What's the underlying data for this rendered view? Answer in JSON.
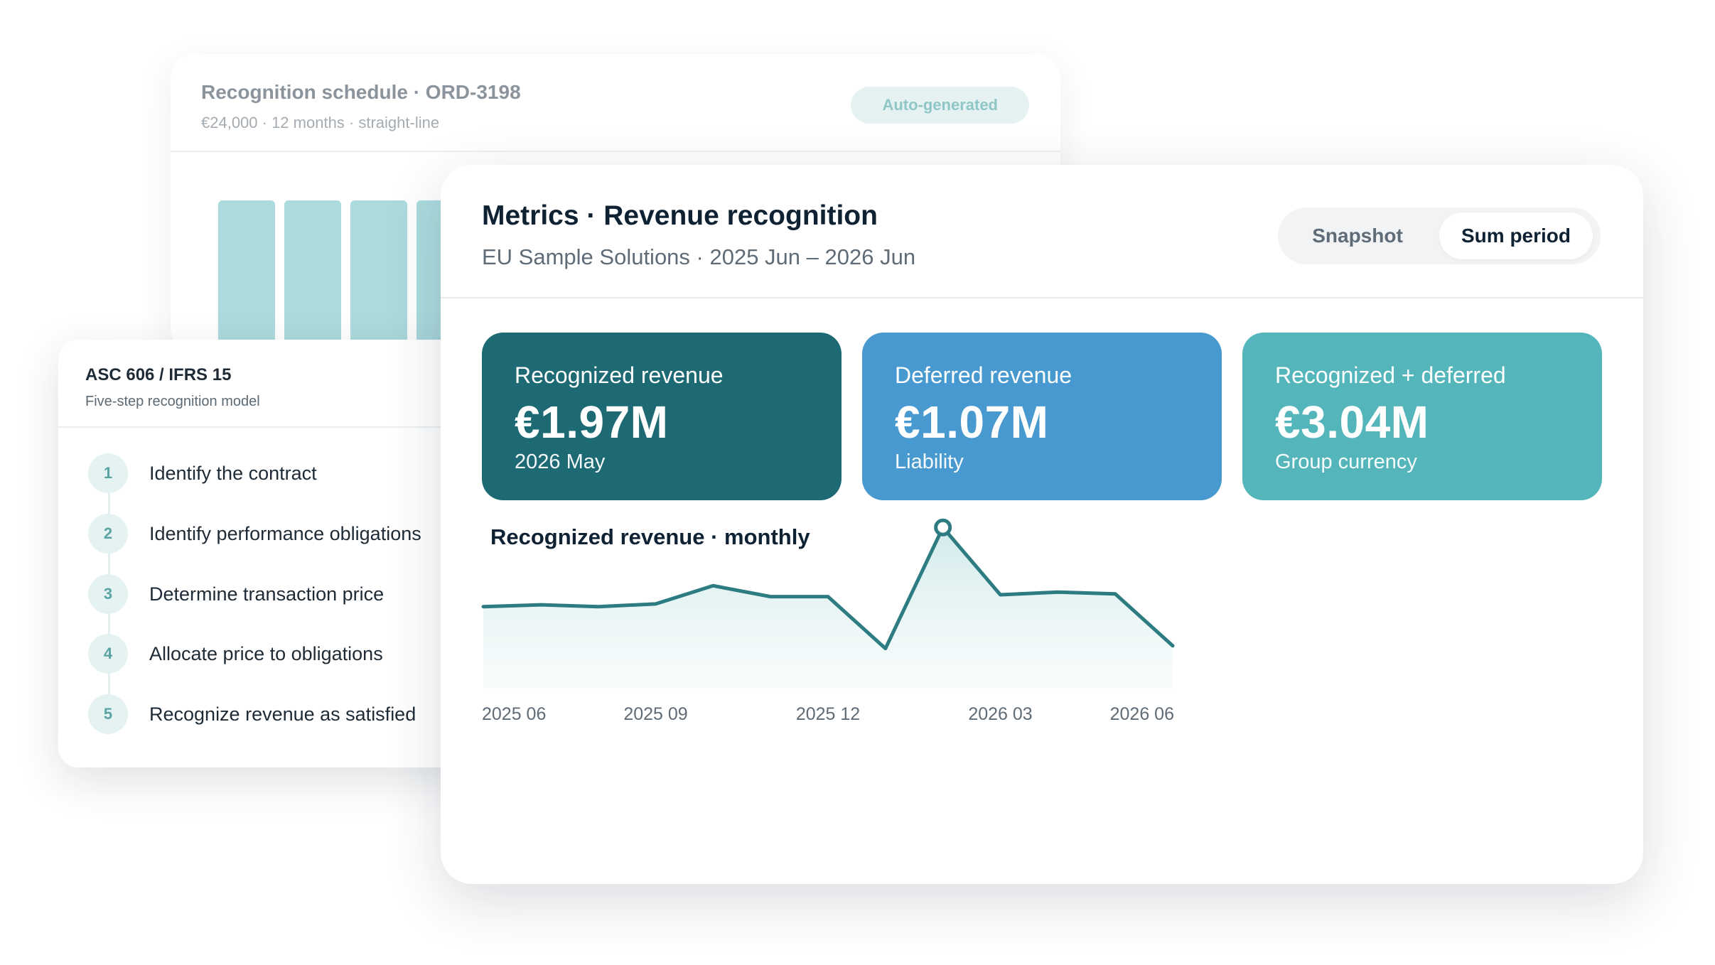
{
  "schedule_card": {
    "title": "Recognition schedule · ORD-3198",
    "subtitle": "€24,000 · 12 months · straight-line",
    "badge": "Auto-generated"
  },
  "asc_card": {
    "title": "ASC 606 / IFRS 15",
    "subtitle": "Five-step recognition model",
    "steps": [
      {
        "num": "1",
        "label": "Identify the contract"
      },
      {
        "num": "2",
        "label": "Identify performance obligations"
      },
      {
        "num": "3",
        "label": "Determine transaction price"
      },
      {
        "num": "4",
        "label": "Allocate price to obligations"
      },
      {
        "num": "5",
        "label": "Recognize revenue as satisfied"
      }
    ]
  },
  "metrics": {
    "title": "Metrics · Revenue recognition",
    "subtitle": "EU Sample Solutions · 2025 Jun – 2026 Jun",
    "toggle": {
      "snapshot": "Snapshot",
      "sum_period": "Sum period",
      "selected": "Sum period"
    },
    "kpis": [
      {
        "label": "Recognized revenue",
        "value": "€1.97M",
        "sub": "2026 May",
        "color": "#1e6a74"
      },
      {
        "label": "Deferred revenue",
        "value": "€1.07M",
        "sub": "Liability",
        "color": "#4799cf"
      },
      {
        "label": "Recognized + deferred",
        "value": "€3.04M",
        "sub": "Group currency",
        "color": "#54b6ba"
      }
    ]
  },
  "colors": {
    "line": "#2d7c82",
    "area_top": "#cfe9ea"
  },
  "chart_data": {
    "type": "area",
    "title": "Recognized revenue · monthly",
    "x": [
      "2025 06",
      "2025 07",
      "2025 08",
      "2025 09",
      "2025 10",
      "2025 11",
      "2025 12",
      "2026 01",
      "2026 02",
      "2026 03",
      "2026 04",
      "2026 05",
      "2026 06"
    ],
    "xtick_labels": [
      "2025 06",
      "2025 09",
      "2025 12",
      "2026 03",
      "2026 06"
    ],
    "values": [
      1.5,
      1.52,
      1.5,
      1.53,
      1.73,
      1.61,
      1.61,
      1.04,
      2.37,
      1.63,
      1.66,
      1.64,
      1.07
    ],
    "highlighted_point": "2026 02",
    "grid": false
  }
}
